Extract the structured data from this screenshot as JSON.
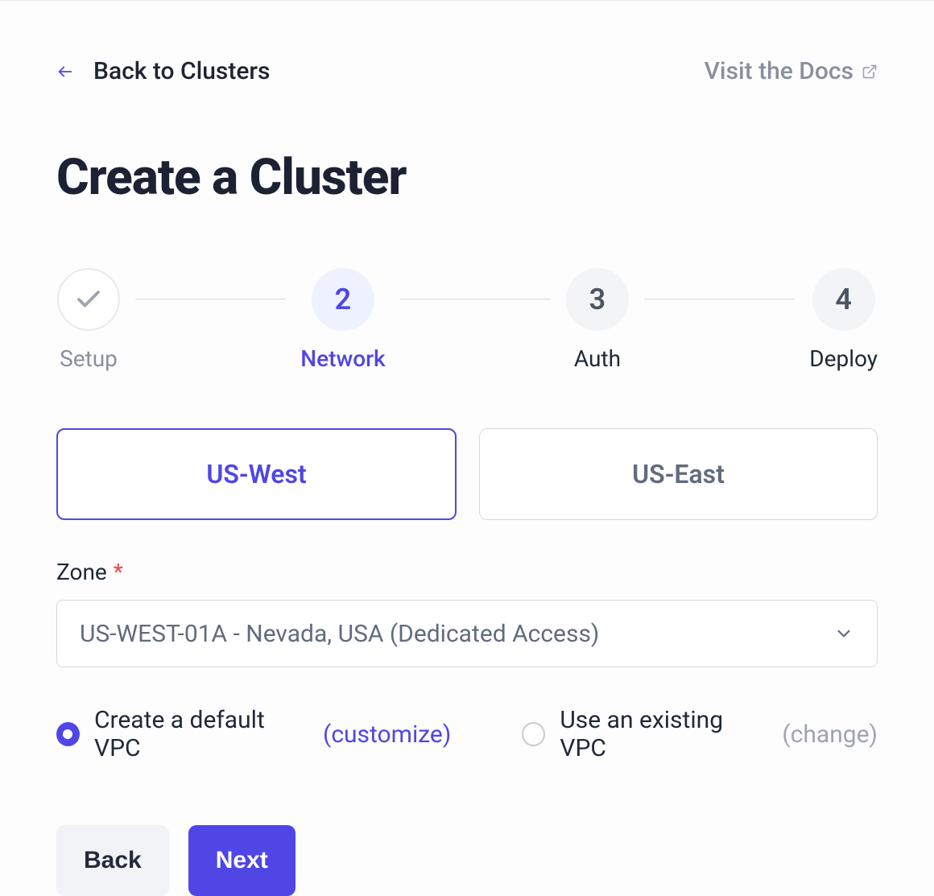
{
  "nav": {
    "back_label": "Back to Clusters",
    "docs_label": "Visit the Docs"
  },
  "page_title": "Create a Cluster",
  "steps": {
    "setup": {
      "label": "Setup"
    },
    "network": {
      "number": "2",
      "label": "Network"
    },
    "auth": {
      "number": "3",
      "label": "Auth"
    },
    "deploy": {
      "number": "4",
      "label": "Deploy"
    }
  },
  "regions": {
    "us_west": "US-West",
    "us_east": "US-East",
    "selected": "US-West"
  },
  "zone": {
    "label": "Zone",
    "selected": "US-WEST-01A - Nevada, USA (Dedicated Access)"
  },
  "vpc": {
    "create_label": "Create a default VPC",
    "create_sub": "(customize)",
    "use_label": "Use an existing VPC",
    "use_sub": "(change)",
    "selected": "create"
  },
  "buttons": {
    "back": "Back",
    "next": "Next"
  }
}
